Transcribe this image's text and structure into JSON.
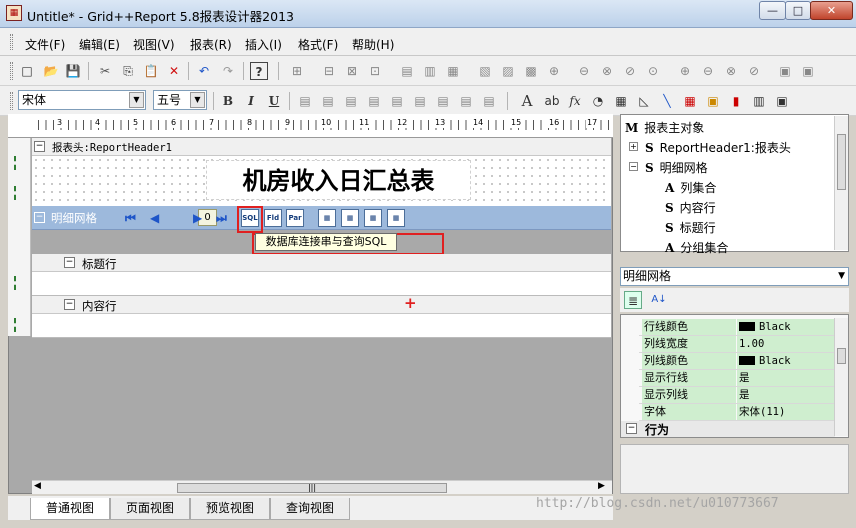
{
  "window": {
    "title": "Untitle* - Grid++Report 5.8报表设计器2013",
    "minimize": "—",
    "maximize": "□",
    "close": "✕"
  },
  "menu": [
    "文件(F)",
    "编辑(E)",
    "视图(V)",
    "报表(R)",
    "插入(I)",
    "格式(F)",
    "帮助(H)"
  ],
  "toolbar1": [
    "□",
    "📂",
    "💾",
    "✂",
    "⎘",
    "📋",
    "✕",
    "↶",
    "↷",
    "?",
    "⊞",
    "⊟",
    "⊠",
    "⊡",
    "▤",
    "▥",
    "▦",
    "▧",
    "▨",
    "▩",
    "⊕",
    "⊖",
    "⊗",
    "⊘",
    "⊙"
  ],
  "font": {
    "name": "宋体",
    "size": "五号"
  },
  "format": {
    "bold": "B",
    "italic": "I",
    "underline": "U",
    "text_a": "A",
    "text_ab": "ab",
    "fx": "fx"
  },
  "ruler_numbers": [
    "3",
    "4",
    "5",
    "6",
    "7",
    "8",
    "9",
    "10",
    "11",
    "12",
    "13",
    "14",
    "15",
    "16",
    "17"
  ],
  "report_header": {
    "label": "报表头:ReportHeader1",
    "title": "机房收入日汇总表"
  },
  "detail_grid": {
    "label": "明细网格",
    "record": "0",
    "tool_sql": "SQL",
    "tooltip": "数据库连接串与查询SQL"
  },
  "bands": {
    "title_row": "标题行",
    "content_row": "内容行"
  },
  "view_tabs": [
    "普通视图",
    "页面视图",
    "预览视图",
    "查询视图"
  ],
  "tree": [
    {
      "glyph": "M",
      "label": "报表主对象",
      "indent": 0
    },
    {
      "glyph": "S",
      "label": "ReportHeader1:报表头",
      "indent": 1,
      "expander": "+"
    },
    {
      "glyph": "S",
      "label": "明细网格",
      "indent": 1,
      "expander": "−"
    },
    {
      "glyph": "A",
      "label": "列集合",
      "indent": 2
    },
    {
      "glyph": "S",
      "label": "内容行",
      "indent": 2
    },
    {
      "glyph": "S",
      "label": "标题行",
      "indent": 2
    },
    {
      "glyph": "A",
      "label": "分组集合",
      "indent": 2
    }
  ],
  "object_selector": "明细网格",
  "properties": [
    {
      "name": "行线颜色",
      "value": "Black",
      "swatch": "#000000"
    },
    {
      "name": "列线宽度",
      "value": "1.00"
    },
    {
      "name": "列线颜色",
      "value": "Black",
      "swatch": "#000000"
    },
    {
      "name": "显示行线",
      "value": "是"
    },
    {
      "name": "显示列线",
      "value": "是"
    },
    {
      "name": "字体",
      "value": "宋体(11)"
    }
  ],
  "prop_category": "行为",
  "watermark": "http://blog.csdn.net/u010773667",
  "colors": {
    "band_blue": "#9db9dc",
    "highlight_red": "#e02020",
    "prop_green": "#cfeecf"
  }
}
